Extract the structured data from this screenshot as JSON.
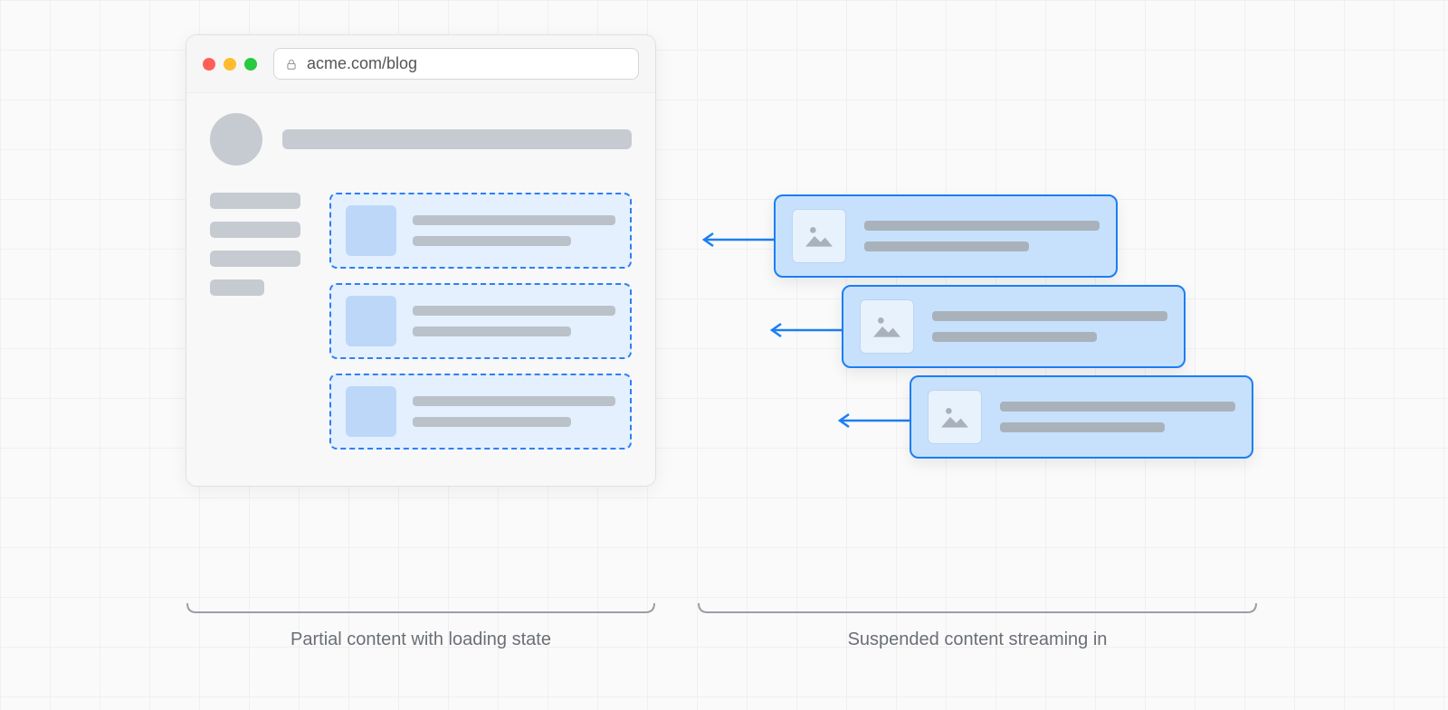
{
  "browser": {
    "url": "acme.com/blog"
  },
  "captions": {
    "left": "Partial content with loading state",
    "right": "Suspended content streaming in"
  },
  "colors": {
    "accent_blue": "#1c7ef3",
    "card_fill": "#c7e1fc",
    "skeleton_gray": "#c6cbd1"
  }
}
